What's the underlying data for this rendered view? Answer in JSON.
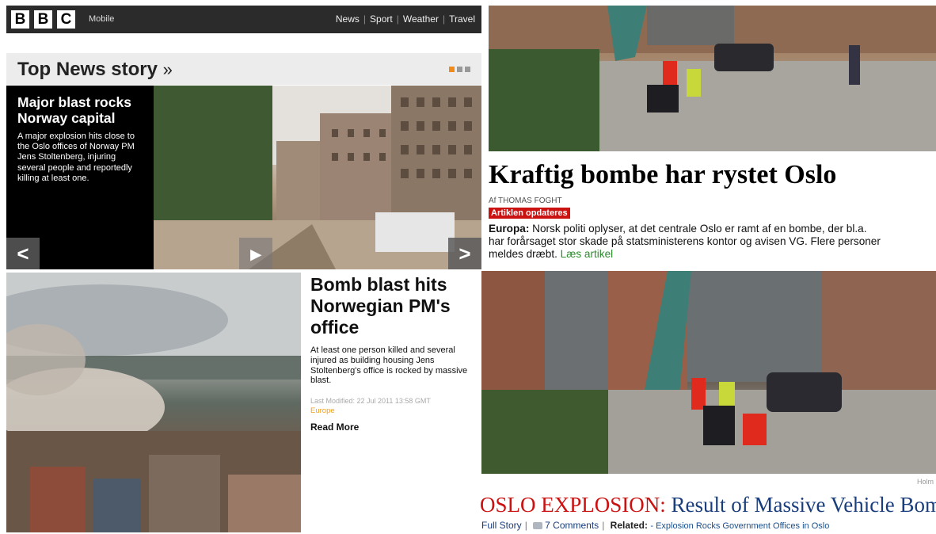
{
  "bbc": {
    "logo_letters": [
      "B",
      "B",
      "C"
    ],
    "mobile_label": "Mobile",
    "nav": [
      "News",
      "Sport",
      "Weather",
      "Travel"
    ],
    "section_title": "Top News story",
    "section_arrow": "»",
    "carousel_pages": 3,
    "carousel_active": 1,
    "hero": {
      "headline": "Major blast rocks Norway capital",
      "summary": "A major explosion hits close to the Oslo offices of Norway PM Jens Stoltenberg, injuring several people and reportedly killing at least one.",
      "prev_icon": "<",
      "next_icon": ">"
    },
    "story2": {
      "headline": "Bomb blast hits Norwegian PM's office",
      "summary": "At least one person killed and several injured as building housing Jens Stoltenberg's office is rocked by massive blast.",
      "last_modified": "Last Modified: 22 Jul 2011 13:58 GMT",
      "tag": "Europe",
      "read_more": "Read More"
    }
  },
  "danish": {
    "headline": "Kraftig bombe har rystet Oslo",
    "author": "Af THOMAS FOGHT",
    "badge": "Artiklen opdateres",
    "body_lead": "Europa:",
    "body_line1": " Norsk politi oplyser, at det centrale Oslo er ramt af en bombe, der bl.a.",
    "body_line2": "har forårsaget stor skade på statsministerens kontor og avisen VG. Flere personer",
    "body_line3": "meldes dræbt.",
    "read_link": "Læs artikel"
  },
  "oslo": {
    "credit": "Holm",
    "headline_red": "OSLO EXPLOSION:",
    "headline_blue": " Result of Massive Vehicle Bomb",
    "full_story": "Full Story",
    "comments": "7 Comments",
    "related_label": "Related:",
    "related_link": "- Explosion Rocks Government Offices in Oslo"
  },
  "colors": {
    "bbc_bar": "#2b2b2b",
    "carousel_active": "#f08a1a",
    "badge_red": "#cc1111",
    "oslo_blue": "#1a3d7c",
    "link_green": "#2a8a2a",
    "tag_orange": "#f0a020"
  }
}
